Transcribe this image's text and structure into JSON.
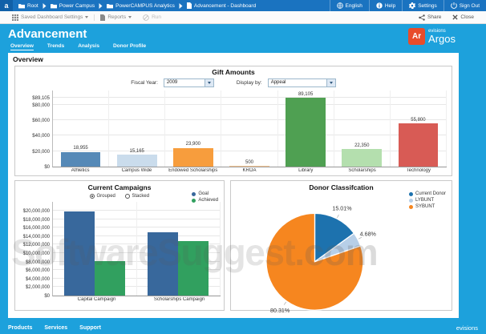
{
  "topbar": {
    "logo_letter": "a",
    "breadcrumbs": [
      {
        "label": "Root",
        "icon": "folder-icon"
      },
      {
        "label": "Power Campus",
        "icon": "folder-icon"
      },
      {
        "label": "PowerCAMPUS Analytics",
        "icon": "folder-icon"
      },
      {
        "label": "Advancement - Dashboard",
        "icon": "dashboard-icon"
      }
    ],
    "actions": [
      {
        "label": "English",
        "icon": "globe-icon"
      },
      {
        "label": "Help",
        "icon": "info-icon"
      },
      {
        "label": "Settings",
        "icon": "gear-icon"
      },
      {
        "label": "Sign Out",
        "icon": "power-icon"
      }
    ]
  },
  "toolbar": {
    "left": [
      {
        "label": "Saved Dashboard Settings",
        "icon": "grid-icon",
        "has_dropdown": true,
        "disabled": false
      },
      {
        "label": "Reports",
        "icon": "document-icon",
        "has_dropdown": true,
        "disabled": false
      },
      {
        "label": "Run",
        "icon": "run-icon",
        "has_dropdown": false,
        "disabled": true
      }
    ],
    "right": [
      {
        "label": "Share",
        "icon": "share-icon"
      },
      {
        "label": "Close",
        "icon": "close-icon"
      }
    ]
  },
  "header": {
    "title": "Advancement",
    "tabs": [
      {
        "label": "Overview",
        "active": true
      },
      {
        "label": "Trends",
        "active": false
      },
      {
        "label": "Analysis",
        "active": false
      },
      {
        "label": "Donor Profile",
        "active": false
      }
    ],
    "brand": {
      "badge": "Ar",
      "badge_color": "#e84c2b",
      "company": "evisions",
      "product": "Argos"
    }
  },
  "content": {
    "section_title": "Overview"
  },
  "chart_data": [
    {
      "type": "bar",
      "title": "Gift Amounts",
      "controls": {
        "fiscal_year_label": "Fiscal Year:",
        "fiscal_year_value": "2009",
        "display_by_label": "Display by:",
        "display_by_value": "Appeal"
      },
      "categories": [
        "Athletics",
        "Campus Wide",
        "Endowed Scholarships",
        "KROA",
        "Library",
        "Scholarships",
        "Technology"
      ],
      "values": [
        18955,
        15165,
        23900,
        500,
        89105,
        22350,
        55800
      ],
      "value_labels": [
        "18,955",
        "15,165",
        "23,900",
        "500",
        "89,105",
        "22,350",
        "55,800"
      ],
      "bar_colors": [
        "#5589b7",
        "#cadcec",
        "#f79d3d",
        "#f9c591",
        "#4fa052",
        "#b4dfae",
        "#d85b55"
      ],
      "ymax": 89105,
      "grid": true,
      "yticks": [
        {
          "v": 0,
          "label": "$0"
        },
        {
          "v": 20000,
          "label": "$20,000"
        },
        {
          "v": 40000,
          "label": "$40,000"
        },
        {
          "v": 60000,
          "label": "$60,000"
        },
        {
          "v": 80000,
          "label": "$80,000"
        },
        {
          "v": 89105,
          "label": "$89,105"
        }
      ]
    },
    {
      "type": "grouped-bar",
      "title": "Current Campaigns",
      "modes": [
        "Grouped",
        "Stacked"
      ],
      "selected_mode": "Grouped",
      "legend_position": "top-right",
      "categories": [
        "Capital Campaign",
        "Scholarships Campaign"
      ],
      "series": [
        {
          "name": "Goal",
          "color": "#38689c",
          "values": [
            19800000,
            14900000
          ]
        },
        {
          "name": "Achieved",
          "color": "#31a05f",
          "values": [
            8200000,
            12900000
          ]
        }
      ],
      "ymax": 20000000,
      "grid": true,
      "yticks": [
        {
          "v": 0,
          "label": "$0"
        },
        {
          "v": 2000000,
          "label": "$2,000,000"
        },
        {
          "v": 4000000,
          "label": "$4,000,000"
        },
        {
          "v": 6000000,
          "label": "$6,000,000"
        },
        {
          "v": 8000000,
          "label": "$8,000,000"
        },
        {
          "v": 10000000,
          "label": "$10,000,000"
        },
        {
          "v": 12000000,
          "label": "$12,000,000"
        },
        {
          "v": 14000000,
          "label": "$14,000,000"
        },
        {
          "v": 16000000,
          "label": "$16,000,000"
        },
        {
          "v": 18000000,
          "label": "$18,000,000"
        },
        {
          "v": 20000000,
          "label": "$20,000,000"
        }
      ]
    },
    {
      "type": "pie",
      "title": "Donor Classifcation",
      "legend_position": "top-right",
      "slices": [
        {
          "name": "Current Donor",
          "pct": 15.01,
          "label": "15.01%",
          "color": "#1d72ae"
        },
        {
          "name": "LYBUNT",
          "pct": 4.68,
          "label": "4.68%",
          "color": "#b7cfe8"
        },
        {
          "name": "SYBUNT",
          "pct": 80.31,
          "label": "80.31%",
          "color": "#f6861f"
        }
      ]
    }
  ],
  "watermark": {
    "text": "SoftwareSuggest",
    "suffix": ".com"
  },
  "footer": {
    "links": [
      "Products",
      "Services",
      "Support"
    ],
    "brand": "evisions"
  }
}
